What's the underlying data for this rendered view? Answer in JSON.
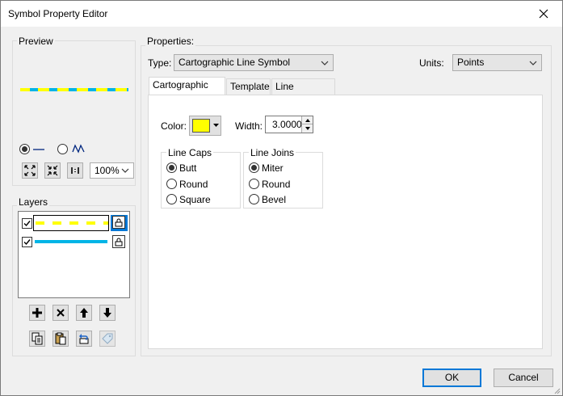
{
  "window": {
    "title": "Symbol Property Editor"
  },
  "preview": {
    "label": "Preview",
    "colors": {
      "dash_primary": "#ffff00",
      "dash_secondary": "#00b4e6"
    },
    "zoom": "100%"
  },
  "layers": {
    "label": "Layers"
  },
  "properties": {
    "label": "Properties:",
    "type_label": "Type:",
    "type_value": "Cartographic Line Symbol",
    "units_label": "Units:",
    "units_value": "Points",
    "tabs": [
      {
        "label": "Cartographic Line"
      },
      {
        "label": "Template"
      },
      {
        "label": "Line Properties"
      }
    ],
    "color_label": "Color:",
    "color_value": "#ffff00",
    "width_label": "Width:",
    "width_value": "3.0000",
    "line_caps": {
      "label": "Line Caps",
      "options": [
        "Butt",
        "Round",
        "Square"
      ],
      "selected": "Butt"
    },
    "line_joins": {
      "label": "Line Joins",
      "options": [
        "Miter",
        "Round",
        "Bevel"
      ],
      "selected": "Miter"
    }
  },
  "footer": {
    "ok_label": "OK",
    "cancel_label": "Cancel"
  }
}
